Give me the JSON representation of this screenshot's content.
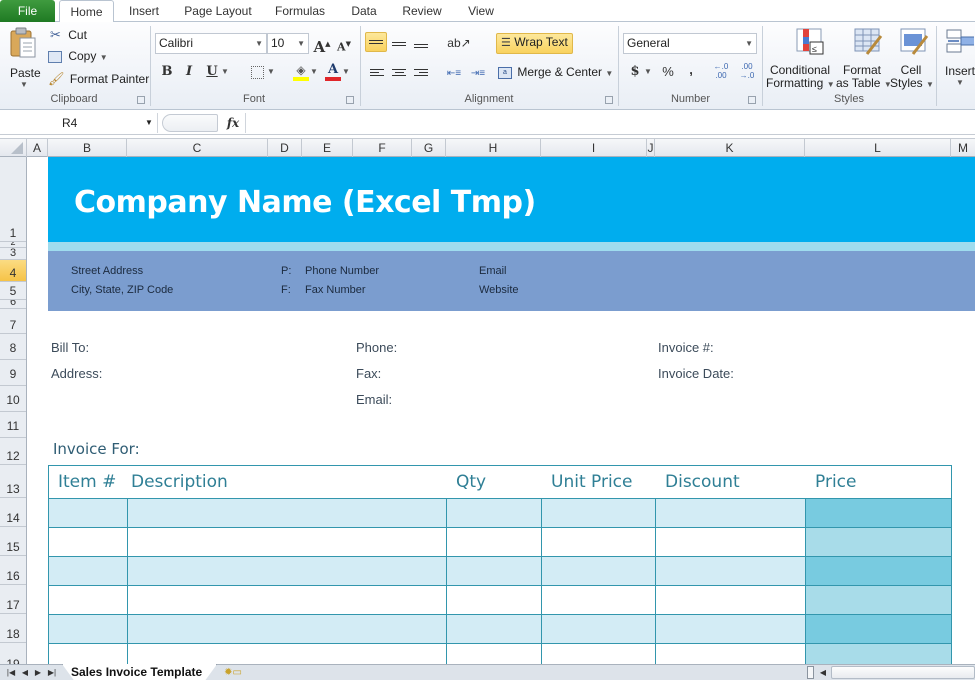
{
  "ribbon": {
    "tabs": [
      {
        "label": "File",
        "active": false
      },
      {
        "label": "Home",
        "active": true
      },
      {
        "label": "Insert",
        "active": false
      },
      {
        "label": "Page Layout",
        "active": false
      },
      {
        "label": "Formulas",
        "active": false
      },
      {
        "label": "Data",
        "active": false
      },
      {
        "label": "Review",
        "active": false
      },
      {
        "label": "View",
        "active": false
      }
    ],
    "clipboard": {
      "group_label": "Clipboard",
      "paste": "Paste",
      "cut": "Cut",
      "copy": "Copy",
      "format_painter": "Format Painter"
    },
    "font": {
      "group_label": "Font",
      "font_name": "Calibri",
      "font_size": "10",
      "bold": "B",
      "italic": "I",
      "underline": "U",
      "grow": "A",
      "shrink": "A",
      "font_color_glyph": "A",
      "fill_color": "#ffff00",
      "font_color": "#e0262a"
    },
    "alignment": {
      "group_label": "Alignment",
      "wrap_text": "Wrap Text",
      "merge_center": "Merge & Center",
      "top_align_active": true,
      "wrap_text_active": true
    },
    "number": {
      "group_label": "Number",
      "format": "General",
      "currency": "$",
      "percent": "%",
      "comma": ",",
      "inc_decimal": "←.0 .00",
      "dec_decimal": ".00 →.0"
    },
    "styles": {
      "group_label": "Styles",
      "conditional_formatting": [
        "Conditional",
        "Formatting"
      ],
      "format_as_table": [
        "Format",
        "as Table"
      ],
      "cell_styles": [
        "Cell",
        "Styles"
      ]
    },
    "cells": {
      "insert": "Insert"
    }
  },
  "formula_bar": {
    "name_box": "R4",
    "fx": "fx",
    "formula": ""
  },
  "grid": {
    "columns": [
      "A",
      "B",
      "C",
      "D",
      "E",
      "F",
      "G",
      "H",
      "I",
      "J",
      "K",
      "L",
      "M"
    ],
    "rows": [
      "1",
      "2",
      "3",
      "4",
      "5",
      "6",
      "7",
      "8",
      "9",
      "10",
      "11",
      "12",
      "13",
      "14",
      "15",
      "16",
      "17",
      "18",
      "19"
    ],
    "selected_row": "4"
  },
  "invoice": {
    "company_name": "Company Name (Excel Tmp)",
    "banner_color": "#00adee",
    "address_band_color": "#7b9dcf",
    "street_address": "Street Address",
    "city_state_zip": "City, State, ZIP Code",
    "phone_prefix": "P:",
    "phone_number": "Phone Number",
    "fax_prefix": "F:",
    "fax_number": "Fax Number",
    "email": "Email",
    "website": "Website",
    "bill_to": "Bill To:",
    "address": "Address:",
    "phone": "Phone:",
    "fax": "Fax:",
    "email_label": "Email:",
    "invoice_number": "Invoice #:",
    "invoice_date": "Invoice Date:",
    "invoice_for": "Invoice For:",
    "table": {
      "headers": [
        "Item #",
        "Description",
        "Qty",
        "Unit Price",
        "Discount",
        "Price"
      ],
      "rows": [
        [
          "",
          "",
          "",
          "",
          "",
          ""
        ],
        [
          "",
          "",
          "",
          "",
          "",
          ""
        ],
        [
          "",
          "",
          "",
          "",
          "",
          ""
        ],
        [
          "",
          "",
          "",
          "",
          "",
          ""
        ],
        [
          "",
          "",
          "",
          "",
          "",
          ""
        ],
        [
          "",
          "",
          "",
          "",
          "",
          ""
        ]
      ],
      "band_color": "#d3ecf5",
      "price_band_dark": "#78cbe0",
      "price_band_light": "#a8dce9",
      "border_color": "#3296ad"
    }
  },
  "sheet_tabs": {
    "active": "Sales Invoice Template"
  }
}
